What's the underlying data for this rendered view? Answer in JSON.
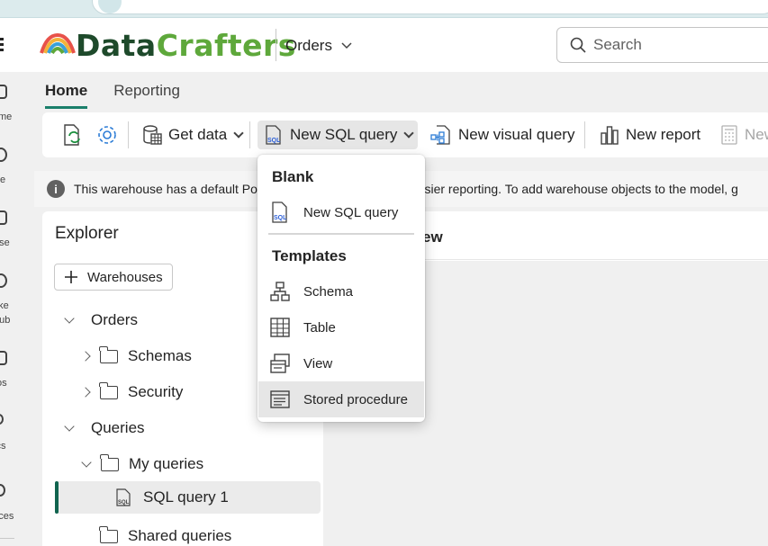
{
  "header": {
    "app_name_part1": "Data",
    "app_name_part2": "Crafters",
    "workspace": "Orders",
    "search_placeholder": "Search"
  },
  "left_rail": {
    "items": [
      "me",
      "te",
      "use",
      "ake",
      "hub",
      "os",
      "ics",
      "paces"
    ]
  },
  "ribbon_tabs": [
    "Home",
    "Reporting"
  ],
  "toolbar": {
    "get_data": "Get data",
    "new_sql_query": "New SQL query",
    "new_visual_query": "New visual query",
    "new_report": "New report",
    "new_cut": "New"
  },
  "info_bar": {
    "text_left": "This warehouse has a default Po",
    "text_right": "easier reporting. To add warehouse objects to the model, g"
  },
  "explorer": {
    "title": "Explorer",
    "warehouses_button": "Warehouses",
    "tree": {
      "orders": "Orders",
      "schemas": "Schemas",
      "security": "Security",
      "queries": "Queries",
      "my_queries": "My queries",
      "sql_query_1": "SQL query 1",
      "shared_queries": "Shared queries"
    }
  },
  "canvas": {
    "header_fragment": "ew"
  },
  "dropdown": {
    "blank_heading": "Blank",
    "blank_items": [
      "New SQL query"
    ],
    "templates_heading": "Templates",
    "template_items": [
      "Schema",
      "Table",
      "View",
      "Stored procedure"
    ]
  }
}
